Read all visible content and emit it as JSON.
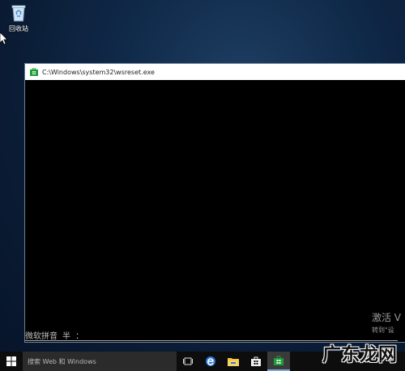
{
  "desktop": {
    "icons": [
      {
        "label": "回收站",
        "icon": "recycle-bin-icon"
      }
    ]
  },
  "console": {
    "title": "C:\\Windows\\system32\\wsreset.exe",
    "title_icon": "store-bag-icon",
    "ime_text": "微软拼音 半 ："
  },
  "activation": {
    "line1": "激活 V",
    "line2": "转到\"设"
  },
  "taskbar": {
    "search_placeholder": "搜索 Web 和 Windows",
    "icons": [
      "windows-start-icon",
      "task-view-icon",
      "edge-icon",
      "file-explorer-icon",
      "store-icon",
      "store-active-icon"
    ]
  },
  "watermark": "广东龙网",
  "colors": {
    "store_green": "#1f9d3a",
    "accent": "#7aa6d8"
  }
}
